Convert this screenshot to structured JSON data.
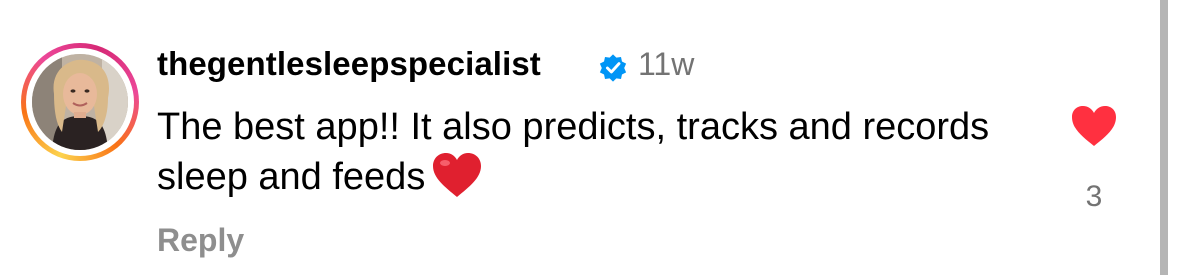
{
  "comment": {
    "username": "thegentlesleepspecialist",
    "verified": true,
    "timestamp": "11w",
    "text": "The best app!! It also predicts, tracks and records sleep and feeds",
    "text_emoji": "red-heart-emoji",
    "reply_label": "Reply",
    "like_count": "3",
    "liked": true
  },
  "colors": {
    "like_red": "#ff3040",
    "verified_blue": "#0095f6",
    "muted_text": "#737373"
  },
  "icons": {
    "like": "heart-icon",
    "verified": "verified-badge-icon"
  }
}
